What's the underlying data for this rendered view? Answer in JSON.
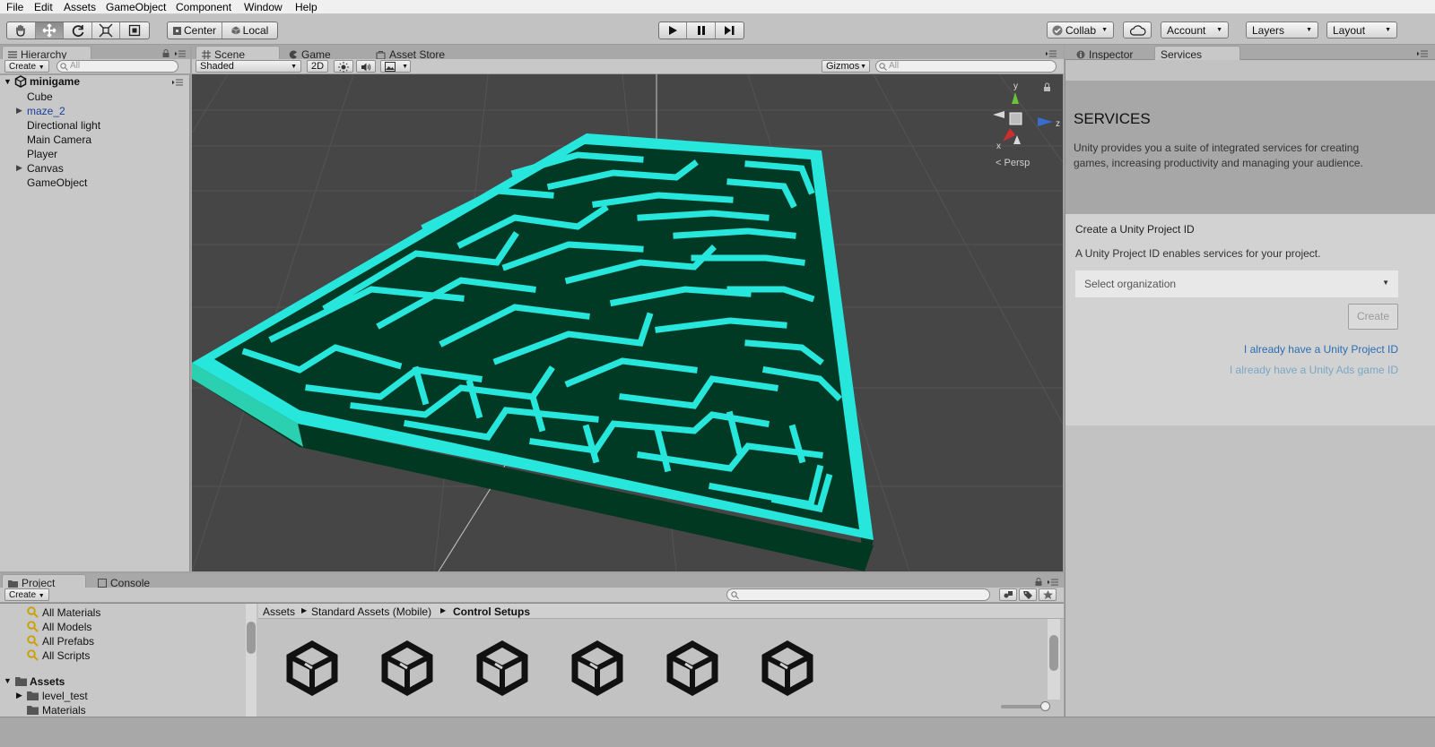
{
  "menu": [
    "File",
    "Edit",
    "Assets",
    "GameObject",
    "Component",
    "Window",
    "Help"
  ],
  "toolbar": {
    "center": "Center",
    "local": "Local",
    "collab": "Collab",
    "account": "Account",
    "layers": "Layers",
    "layout": "Layout"
  },
  "hierarchy": {
    "tab": "Hierarchy",
    "create": "Create",
    "search_placeholder": "All",
    "scene_name": "minigame",
    "items": [
      {
        "label": "Cube",
        "foldout": false,
        "color": "#111111"
      },
      {
        "label": "maze_2",
        "foldout": true,
        "color": "#1a3e9a"
      },
      {
        "label": "Directional light",
        "foldout": false,
        "color": "#111111"
      },
      {
        "label": "Main Camera",
        "foldout": false,
        "color": "#111111"
      },
      {
        "label": "Player",
        "foldout": false,
        "color": "#111111"
      },
      {
        "label": "Canvas",
        "foldout": true,
        "color": "#111111"
      },
      {
        "label": "GameObject",
        "foldout": false,
        "color": "#111111"
      }
    ]
  },
  "scene_view": {
    "tabs": [
      "Scene",
      "Game",
      "Asset Store"
    ],
    "shading": "Shaded",
    "mode_2d": "2D",
    "gizmos": "Gizmos",
    "search_placeholder": "All",
    "persp": "Persp",
    "axes": {
      "y": "y",
      "z": "z",
      "x": "x"
    }
  },
  "inspector": {
    "tabs": [
      "Inspector",
      "Services"
    ],
    "title": "SERVICES",
    "description": "Unity provides you a suite of integrated services for creating games, increasing productivity and managing your audience.",
    "section_title": "Create a Unity Project ID",
    "section_text": "A Unity Project ID enables services for your project.",
    "select_placeholder": "Select organization",
    "create_button": "Create",
    "link_project_id": "I already have a Unity Project ID",
    "link_ads_id": "I already have a Unity Ads game ID"
  },
  "project": {
    "tabs": [
      "Project",
      "Console"
    ],
    "create": "Create",
    "favorites": [
      "All Materials",
      "All Models",
      "All Prefabs",
      "All Scripts"
    ],
    "assets_root": "Assets",
    "folders": [
      "level_test",
      "Materials"
    ],
    "breadcrumb": [
      "Assets",
      "Standard Assets (Mobile)",
      "Control Setups"
    ]
  },
  "colors": {
    "maze_top": "#27e7dd",
    "maze_side": "#003822",
    "link": "#2a6db2",
    "link_disabled": "#78a8c5"
  }
}
